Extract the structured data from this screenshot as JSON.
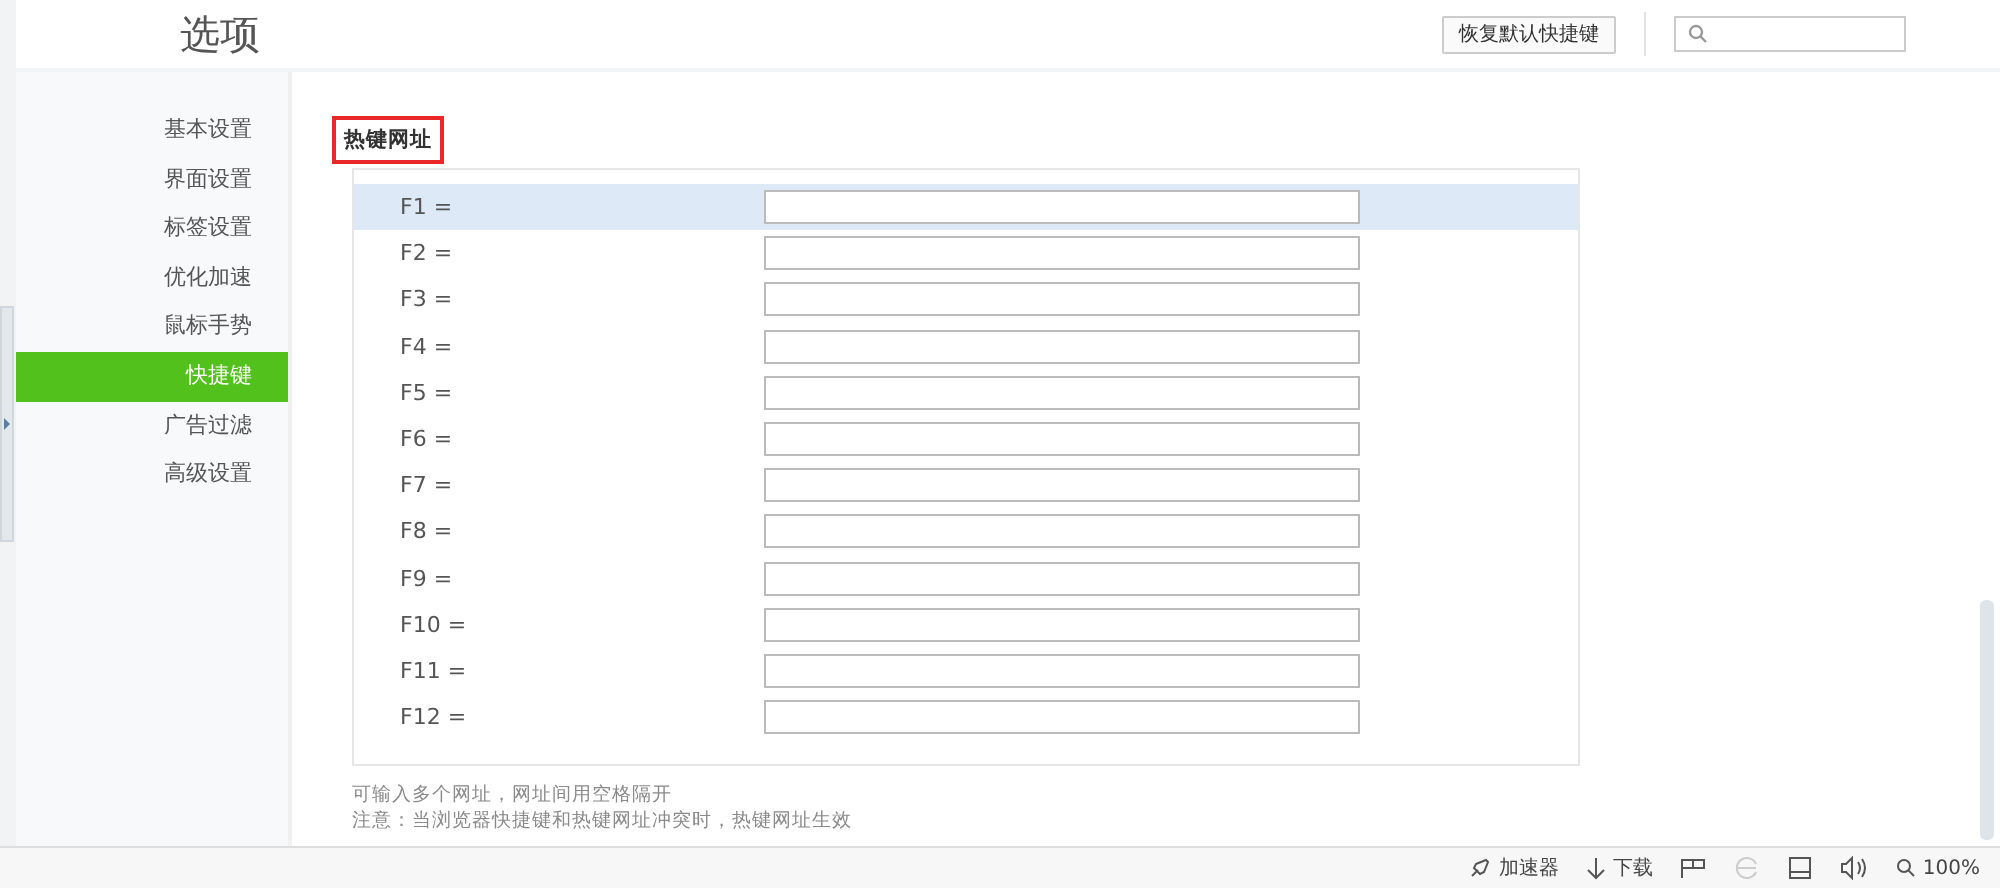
{
  "header": {
    "title": "选项",
    "reset_button": "恢复默认快捷键"
  },
  "sidebar": {
    "items": [
      {
        "label": "基本设置",
        "selected": false
      },
      {
        "label": "界面设置",
        "selected": false
      },
      {
        "label": "标签设置",
        "selected": false
      },
      {
        "label": "优化加速",
        "selected": false
      },
      {
        "label": "鼠标手势",
        "selected": false
      },
      {
        "label": "快捷键",
        "selected": true
      },
      {
        "label": "广告过滤",
        "selected": false
      },
      {
        "label": "高级设置",
        "selected": false
      }
    ]
  },
  "section": {
    "title": "热键网址",
    "highlighted": true
  },
  "rows": [
    {
      "label": "F1 =",
      "hovered": true
    },
    {
      "label": "F2 =",
      "hovered": false
    },
    {
      "label": "F3 =",
      "hovered": false
    },
    {
      "label": "F4 =",
      "hovered": false
    },
    {
      "label": "F5 =",
      "hovered": false
    },
    {
      "label": "F6 =",
      "hovered": false
    },
    {
      "label": "F7 =",
      "hovered": false
    },
    {
      "label": "F8 =",
      "hovered": false
    },
    {
      "label": "F9 =",
      "hovered": false
    },
    {
      "label": "F10 =",
      "hovered": false
    },
    {
      "label": "F11 =",
      "hovered": false
    },
    {
      "label": "F12 =",
      "hovered": false
    }
  ],
  "notes": [
    "可输入多个网址，网址间用空格隔开",
    "注意：当浏览器快捷键和热键网址冲突时，热键网址生效"
  ],
  "status_bar": {
    "accelerator": "加速器",
    "download": "下载",
    "zoom": "100%"
  }
}
